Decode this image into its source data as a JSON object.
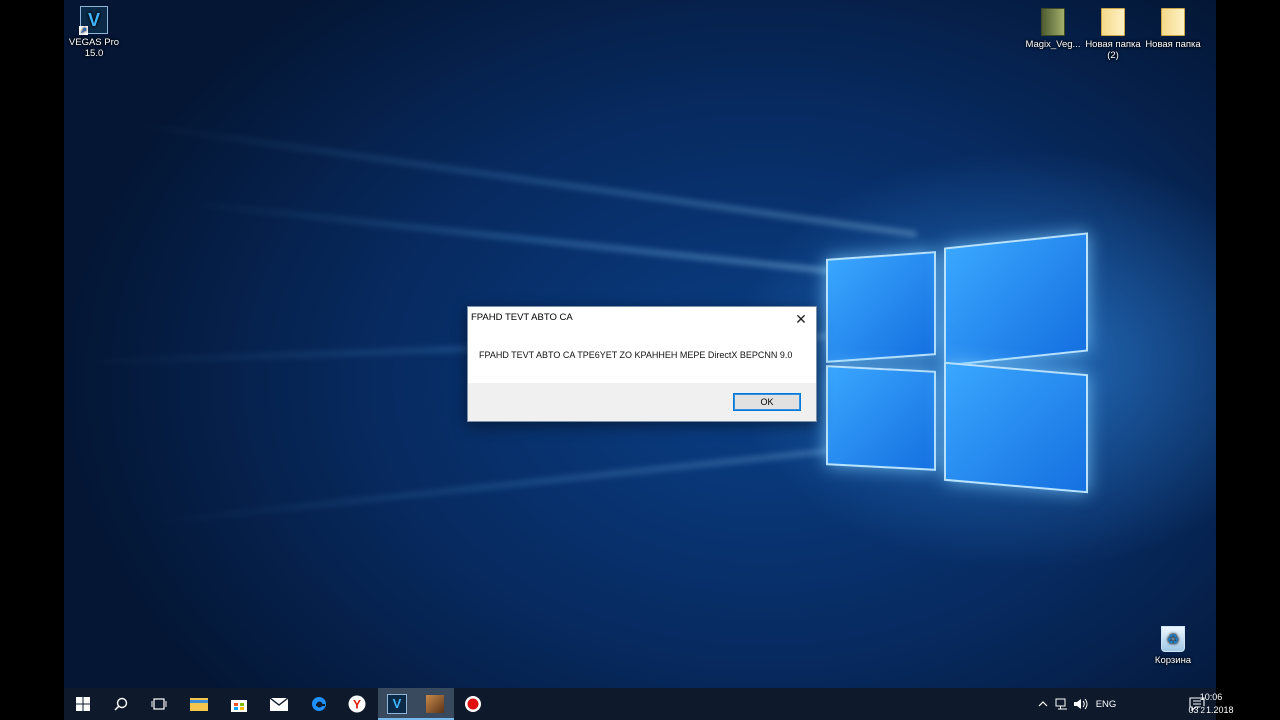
{
  "desktop": {
    "icons": [
      {
        "label_line1": "VEGAS Pro",
        "label_line2": "15.0",
        "glyph": "V"
      },
      {
        "label_line1": "Magix_Veg...",
        "label_line2": ""
      },
      {
        "label_line1": "Новая папка",
        "label_line2": "(2)"
      },
      {
        "label_line1": "Новая папка",
        "label_line2": ""
      },
      {
        "label_line1": "Корзина",
        "label_line2": ""
      }
    ]
  },
  "dialog": {
    "title": "FPAHD TEVT ABTO CA",
    "message": "FPAHD TEVT ABTO CA TPE6YET ZO KPAHHEH MEPE DirectX BEPCNN 9.0",
    "ok_label": "OK",
    "close_glyph": "✕"
  },
  "taskbar": {
    "vegas_glyph": "V",
    "tray": {
      "language": "ENG",
      "notifications_count": "2"
    },
    "clock": {
      "time": "10:06",
      "date": "03.01.2018"
    }
  },
  "colors": {
    "accent": "#0078d7",
    "taskbar": "#0e1a2b",
    "wallpaper": "#0a3f86"
  }
}
